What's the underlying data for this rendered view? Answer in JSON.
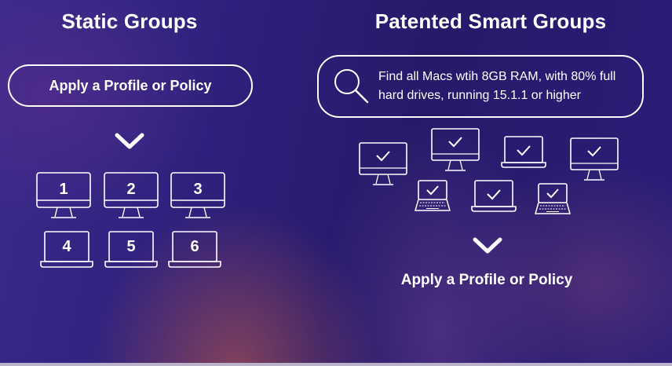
{
  "static_groups": {
    "title": "Static Groups",
    "apply_label": "Apply a Profile or Policy",
    "device_numbers": [
      "1",
      "2",
      "3",
      "4",
      "5",
      "6"
    ]
  },
  "smart_groups": {
    "title": "Patented Smart Groups",
    "search_text_line1": "Find all Macs wtih 8GB RAM, with 80% full",
    "search_text_line2": "hard drives, running 15.1.1 or higher",
    "apply_label": "Apply a Profile or Policy"
  },
  "colors": {
    "background": "#2d1f7a",
    "accent_warm": "#c85f46",
    "foreground": "#ffffff"
  },
  "icons": [
    "search-icon",
    "chevron-down-icon",
    "desktop-icon",
    "laptop-icon",
    "checkmark-icon"
  ]
}
